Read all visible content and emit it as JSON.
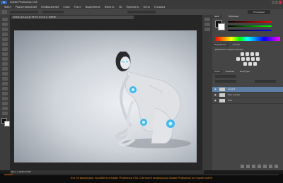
{
  "window": {
    "title": "Adobe Photoshop CS6"
  },
  "menu": [
    "Файл",
    "Редактирование",
    "Изображение",
    "Слои",
    "Текст",
    "Выделение",
    "Фильтр",
    "3D",
    "Просмотр",
    "Окно",
    "Справка"
  ],
  "options": {
    "mode_label": "Основные"
  },
  "document": {
    "tab": "Robot_girl.jpg @ 33,3% (Слой 1, RGB/8)",
    "status": "Док: 2,25M/4,50M"
  },
  "panels": {
    "color_tab": "Цвет",
    "swatches_tab": "Образцы",
    "adjust_tab": "Коррекция",
    "styles_tab": "Стили",
    "adjust_title": "Добавить корректировку",
    "layers_tab": "Слои",
    "channels_tab": "Каналы",
    "paths_tab": "Контуры",
    "layers": [
      "Слой 1",
      "Фон копия",
      "Фон"
    ]
  },
  "player": {
    "progress": 0.03,
    "caption": "Это не видеоурок по работе в Adobe Photoshop CS6. Смотрите видеоуроки Adobe Photoshop на нашем сайте"
  },
  "colors": {
    "accent": "#e06d1a",
    "panel": "#454545",
    "selected_layer": "#5d7fa5"
  }
}
